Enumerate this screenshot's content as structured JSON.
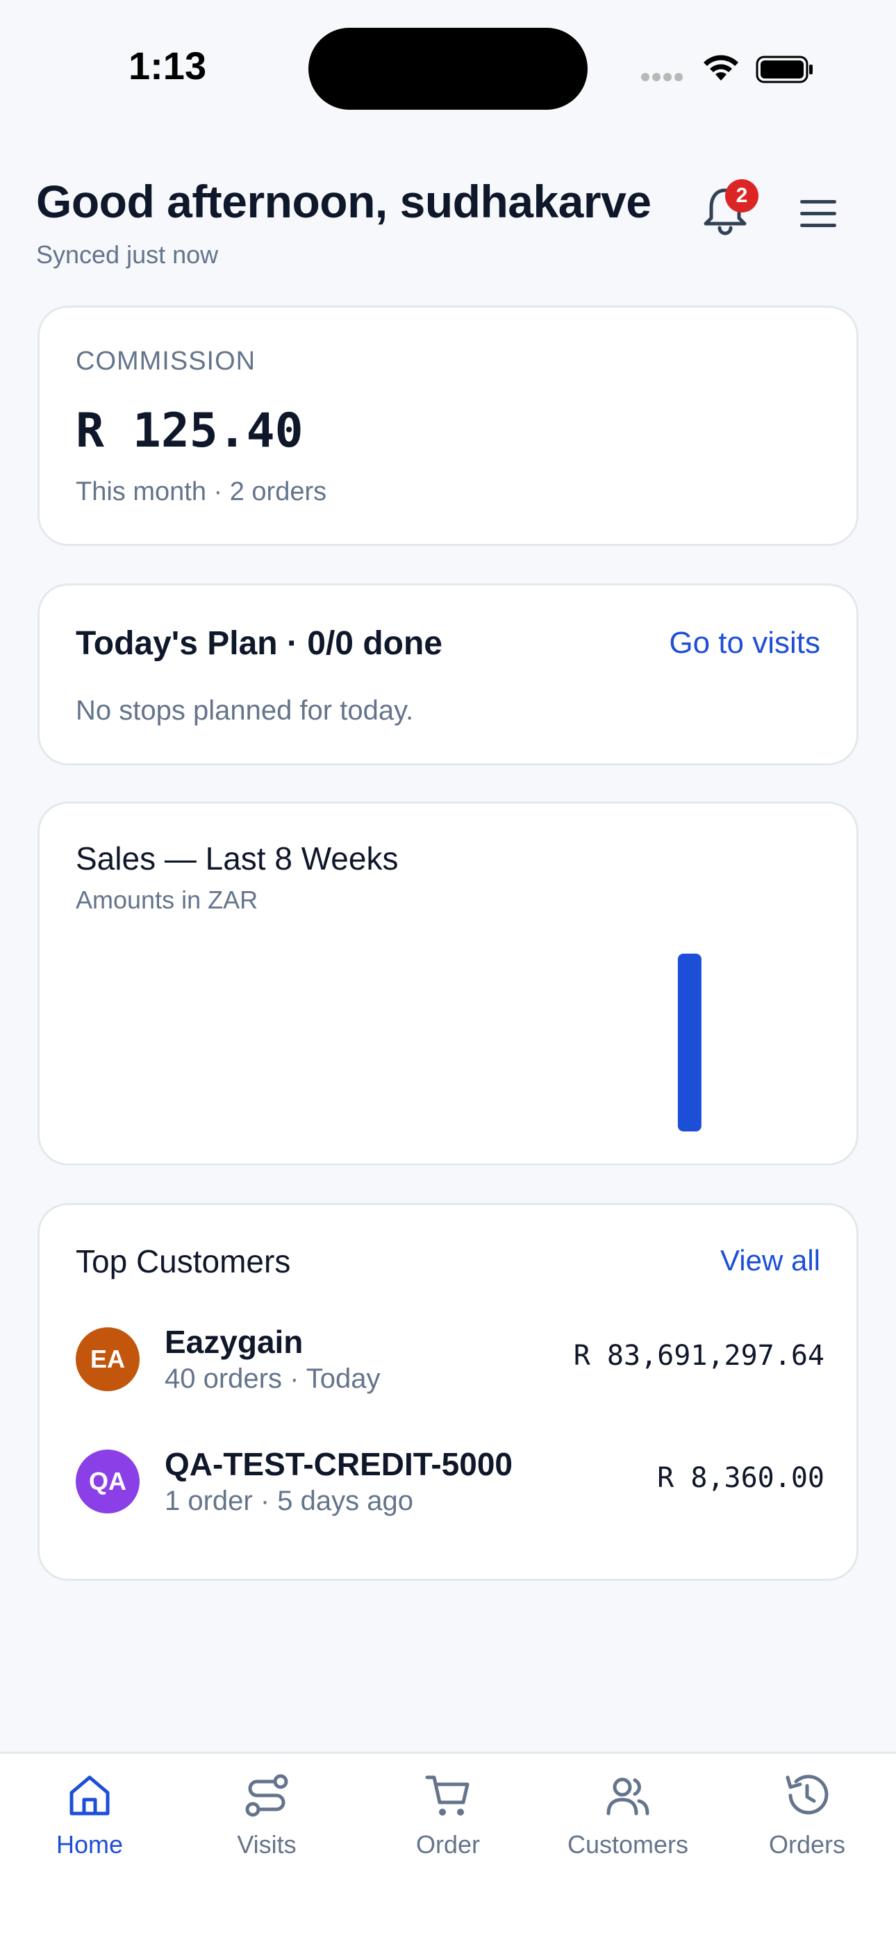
{
  "status_bar": {
    "time": "1:13"
  },
  "header": {
    "greeting": "Good afternoon, sudhakarve",
    "sync_status": "Synced just now",
    "notification_count": "2"
  },
  "commission": {
    "label": "COMMISSION",
    "value": "R 125.40",
    "subtitle": "This month · 2 orders"
  },
  "plan": {
    "title": "Today's Plan · 0/0 done",
    "link": "Go to visits",
    "empty_text": "No stops planned for today."
  },
  "sales": {
    "title": "Sales — Last 8 Weeks",
    "subtitle": "Amounts in ZAR"
  },
  "chart_data": {
    "type": "bar",
    "title": "Sales — Last 8 Weeks",
    "subtitle": "Amounts in ZAR",
    "categories": [
      "",
      "",
      "",
      "",
      "",
      "",
      "",
      ""
    ],
    "values": [
      0,
      0,
      0,
      0,
      0,
      0,
      1,
      0
    ],
    "bar_color": "#1d4ed8",
    "grid": false
  },
  "top_customers": {
    "title": "Top Customers",
    "link": "View all",
    "items": [
      {
        "initials": "EA",
        "name": "Eazygain",
        "meta": "40 orders · Today",
        "amount": "R 83,691,297.64",
        "color": "#c2560c"
      },
      {
        "initials": "QA",
        "name": "QA-TEST-CREDIT-5000",
        "meta": "1 order · 5 days ago",
        "amount": "R 8,360.00",
        "color": "#8b3fe6"
      }
    ]
  },
  "nav": {
    "items": [
      {
        "label": "Home",
        "icon": "home-icon",
        "active": true
      },
      {
        "label": "Visits",
        "icon": "route-icon",
        "active": false
      },
      {
        "label": "Order",
        "icon": "cart-icon",
        "active": false
      },
      {
        "label": "Customers",
        "icon": "users-icon",
        "active": false
      },
      {
        "label": "Orders",
        "icon": "history-icon",
        "active": false
      }
    ]
  },
  "colors": {
    "accent": "#1d4ed8",
    "badge": "#dc2626",
    "muted": "#64748b",
    "background": "#f6f8fb"
  }
}
